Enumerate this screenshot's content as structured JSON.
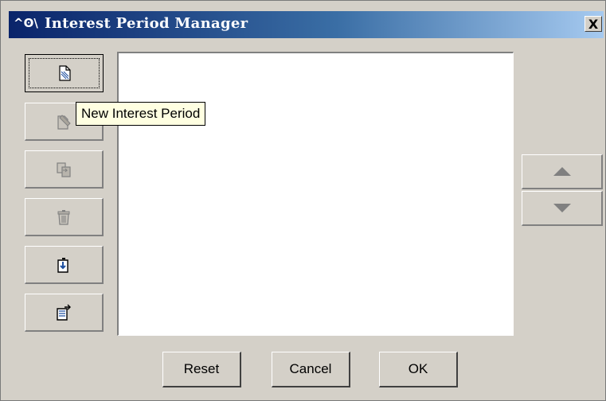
{
  "window": {
    "title_icon": "^ʘ\\",
    "title": "Interest Period Manager",
    "close_label": "X"
  },
  "toolbar": {
    "items": [
      {
        "icon": "new-document-icon",
        "enabled": true,
        "focused": true
      },
      {
        "icon": "edit-document-icon",
        "enabled": false
      },
      {
        "icon": "copy-document-icon",
        "enabled": false
      },
      {
        "icon": "trash-icon",
        "enabled": false
      },
      {
        "icon": "import-icon",
        "enabled": true
      },
      {
        "icon": "export-icon",
        "enabled": true
      }
    ]
  },
  "tooltip": {
    "text": "New Interest Period"
  },
  "list": {
    "items": []
  },
  "reorder": {
    "up_icon": "arrow-up-icon",
    "down_icon": "arrow-down-icon"
  },
  "footer": {
    "reset_label": "Reset",
    "cancel_label": "Cancel",
    "ok_label": "OK"
  }
}
